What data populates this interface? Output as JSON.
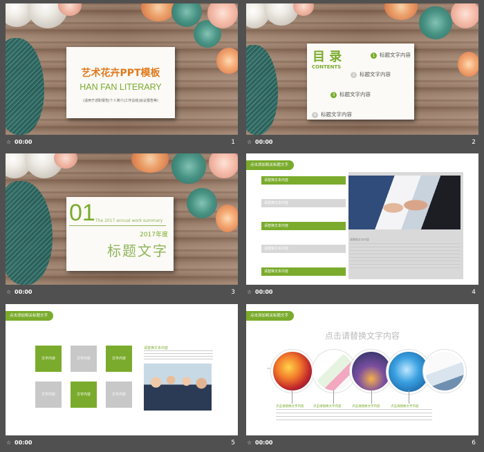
{
  "slides": [
    {
      "number": "1",
      "time": "00:00",
      "title": "艺术花卉PPT模板",
      "subtitle": "HAN FAN LITERARY",
      "note": "(适用于述职报告|个人简介|工作总结|会议报告等)"
    },
    {
      "number": "2",
      "time": "00:00",
      "heading": "目 录",
      "heading_en": "CONTENTS",
      "items": [
        {
          "num": "1",
          "label": "标题文字内容"
        },
        {
          "num": "2",
          "label": "标题文字内容"
        },
        {
          "num": "3",
          "label": "标题文字内容"
        },
        {
          "num": "4",
          "label": "标题文字内容"
        }
      ]
    },
    {
      "number": "3",
      "time": "00:00",
      "section_num": "01",
      "summary_en": "The 2017 annual work summary",
      "year": "2017年度",
      "title": "标题文字"
    },
    {
      "number": "4",
      "time": "00:00",
      "tag": "点击添加相关标题文字",
      "rows": [
        "请替换文本内容",
        "请替换文本内容",
        "请替换文本内容",
        "请替换文本内容",
        "请替换文本内容"
      ],
      "caption": "请替换文本内容"
    },
    {
      "number": "5",
      "time": "00:00",
      "tag": "点击添加相关标题文字",
      "puzzle": [
        "文字内容",
        "文字内容",
        "文字内容",
        "文字内容",
        "文字内容",
        "文字内容"
      ],
      "caption": "请替换文本内容"
    },
    {
      "number": "6",
      "time": "00:00",
      "tag": "点击添加相关标题文字",
      "title": "点击请替换文字内容",
      "captions": [
        "点击请替换文字内容",
        "点击请替换文字内容",
        "点击请替换文字内容",
        "点击请替换文字内容"
      ]
    }
  ],
  "colors": {
    "accent": "#7aab2c",
    "orange": "#e07a1e",
    "background": "#505050"
  }
}
